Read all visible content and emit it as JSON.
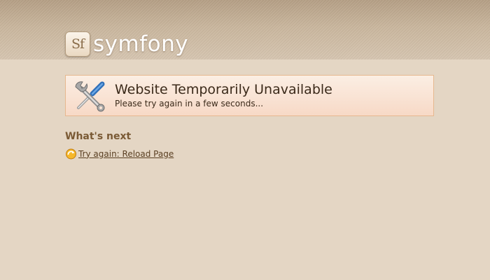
{
  "header": {
    "logo_badge": "Sf",
    "logo_text": "symfony"
  },
  "notice": {
    "icon": "tools-icon",
    "title": "Website Temporarily Unavailable",
    "subtitle": "Please try again in a few seconds..."
  },
  "next": {
    "heading": "What's next",
    "reload_icon": "reload-arrow-icon",
    "reload_link": "Try again: Reload Page"
  },
  "colors": {
    "page_background": "#e4d6c4",
    "notice_background": "#f9e3d4",
    "notice_border": "#e6b88f",
    "heading": "#7a5a35"
  }
}
